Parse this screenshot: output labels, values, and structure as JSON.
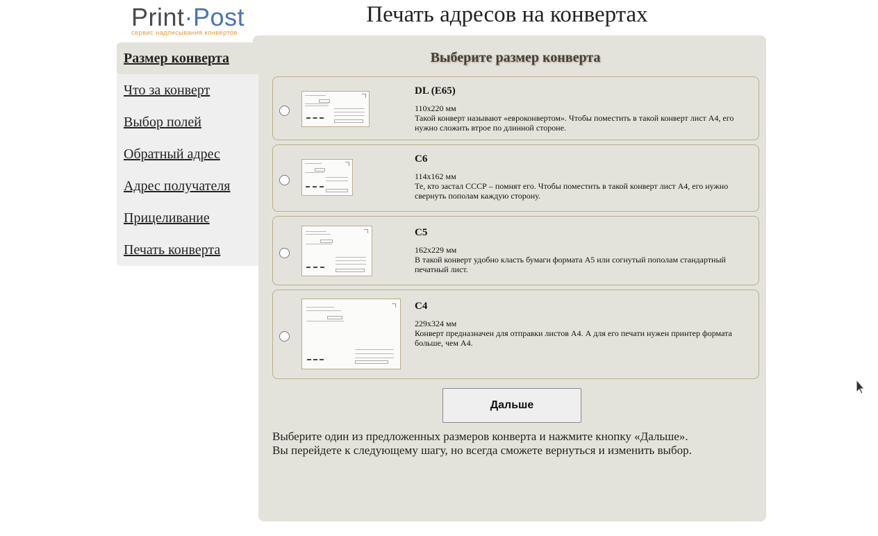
{
  "logo": {
    "print": "Print",
    "dot": "·",
    "post": "Post",
    "tagline": "сервис надписывания конвертов"
  },
  "page_title": "Печать адресов на конвертах",
  "sidebar": {
    "items": [
      {
        "label": "Размер конверта",
        "active": true
      },
      {
        "label": "Что за конверт"
      },
      {
        "label": "Выбор полей"
      },
      {
        "label": "Обратный адрес"
      },
      {
        "label": "Адрес получателя"
      },
      {
        "label": "Прицеливание"
      },
      {
        "label": "Печать конверта"
      }
    ]
  },
  "main": {
    "subtitle": "Выберите размер конверта",
    "options": [
      {
        "name": "DL (E65)",
        "dims": "110x220 мм",
        "desc": "Такой конверт называют «евроконвертом». Чтобы поместить в такой конверт лист А4, его нужно сложить втрое по длинной стороне.",
        "selected": false
      },
      {
        "name": "C6",
        "dims": "114x162 мм",
        "desc": "Те, кто застал СССР – помнят его. Чтобы поместить в такой конверт лист А4, его нужно свернуть пополам каждую сторону.",
        "selected": false
      },
      {
        "name": "C5",
        "dims": "162x229 мм",
        "desc": "В такой конверт удобно класть бумаги формата А5 или согнутый пополам стандартный печатный лист.",
        "selected": false
      },
      {
        "name": "C4",
        "dims": "229x324 мм",
        "desc": "Конверт предназначен для отправки листов А4. А для его печати нужен принтер формата больше, чем А4.",
        "selected": false
      }
    ],
    "next_button": "Дальше",
    "hint_line1": "Выберите один из предложенных размеров конверта и нажмите кнопку «Дальше».",
    "hint_line2": "Вы перейдете к следующему шагу, но всегда сможете вернуться и изменить выбор."
  }
}
